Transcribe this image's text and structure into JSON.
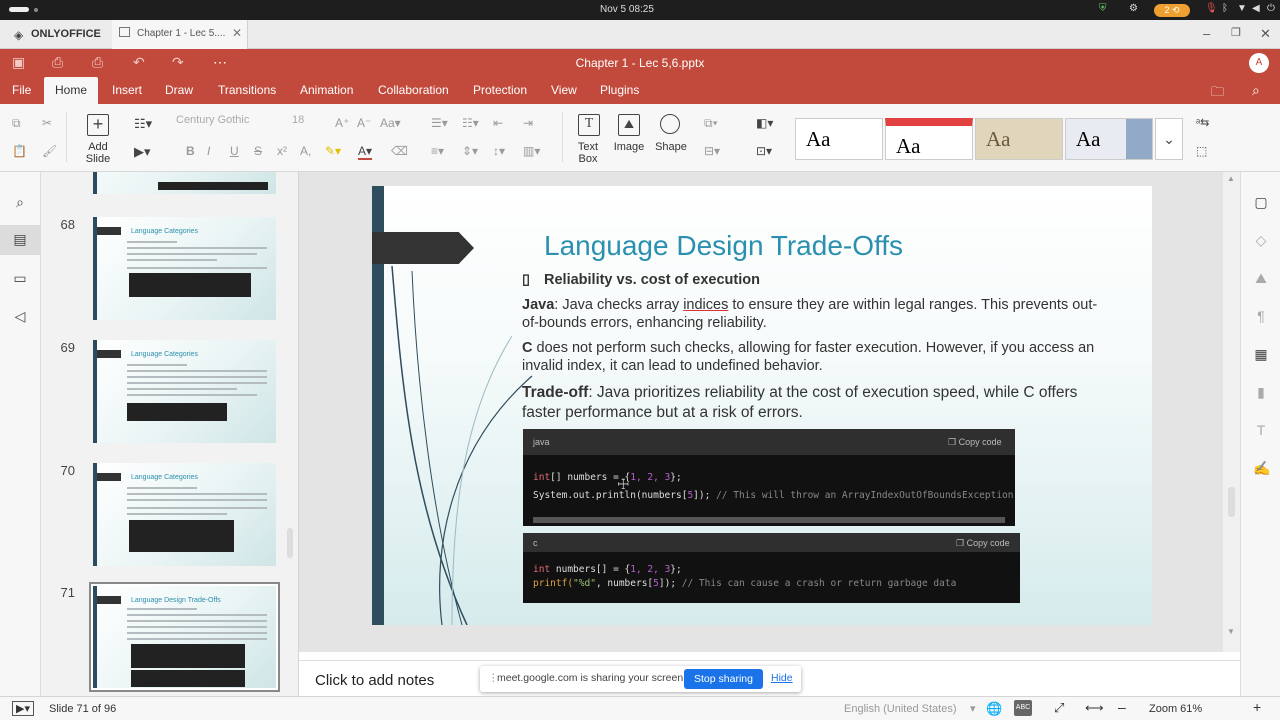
{
  "os": {
    "clock": "Nov 5  08:25",
    "indicator": "2  ⟲"
  },
  "app": {
    "brand": "ONLYOFFICE",
    "tab_title": "Chapter 1 - Lec 5....",
    "window_title": "Chapter 1 - Lec 5,6.pptx",
    "avatar_initial": "A"
  },
  "menu": {
    "items": [
      "File",
      "Home",
      "Insert",
      "Draw",
      "Transitions",
      "Animation",
      "Collaboration",
      "Protection",
      "View",
      "Plugins"
    ],
    "active": "Home"
  },
  "toolbar": {
    "add_slide_label": "Add Slide",
    "font_name": "Century Gothic",
    "font_size": "18",
    "text_box_label": "Text Box",
    "image_label": "Image",
    "shape_label": "Shape",
    "theme_sample": "Aa"
  },
  "thumbnails": [
    {
      "num": "68",
      "title": "Language Categories"
    },
    {
      "num": "69",
      "title": "Language Categories"
    },
    {
      "num": "70",
      "title": "Language Categories"
    },
    {
      "num": "71",
      "title": "Language Design Trade-Offs",
      "selected": true
    }
  ],
  "slide": {
    "title": "Language Design Trade-Offs",
    "bullet": "Reliability vs. cost of execution",
    "para1_bold": "Java",
    "para1_a": ": Java checks array ",
    "para1_link": "indices",
    "para1_b": " to ensure they are within legal ranges. This prevents out-of-bounds errors, enhancing reliability.",
    "para2_bold": "C",
    "para2_rest": " does not perform such checks, allowing for faster execution. However, if you access an invalid index, it can lead to undefined behavior.",
    "para3_bold": "Trade-off",
    "para3_rest": ": Java prioritizes reliability at the cost of execution speed, while C offers faster performance but at a risk of errors.",
    "code1": {
      "lang": "java",
      "copy": "Copy code",
      "line1_kw": "int",
      "line1_a": "[] numbers = {",
      "line1_nums": "1, 2, 3",
      "line1_b": "};",
      "line2_a": "System.out.println(numbers[",
      "line2_idx": "5",
      "line2_b": "]); ",
      "line2_comment": "// This will throw an ArrayIndexOutOfBoundsException"
    },
    "code2": {
      "lang": "c",
      "copy": "Copy code",
      "line1_kw": "int",
      "line1_a": " numbers[] = {",
      "line1_nums": "1, 2, 3",
      "line1_b": "};",
      "line2_fn": "printf(",
      "line2_str": "\"%d\"",
      "line2_a": ", numbers[",
      "line2_idx": "5",
      "line2_b": "]); ",
      "line2_comment": "// This can cause a crash or return garbage data"
    }
  },
  "notes_placeholder": "Click to add notes",
  "share_banner": {
    "message": "meet.google.com is sharing your screen.",
    "stop": "Stop sharing",
    "hide": "Hide"
  },
  "status": {
    "slide_info": "Slide 71 of 96",
    "language": "English (United States)",
    "zoom": "Zoom 61%"
  },
  "colors": {
    "accent": "#c24a3c",
    "title_blue": "#2a90b0",
    "code_keyword": "#e06c75",
    "code_number": "#b85fd0",
    "link_blue": "#1a73e8"
  }
}
